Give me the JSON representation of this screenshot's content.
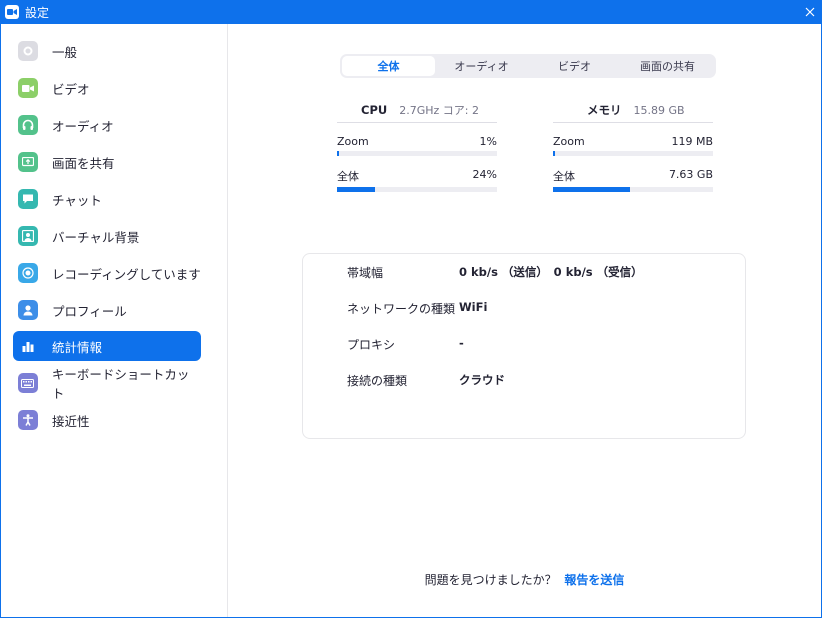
{
  "window": {
    "title": "設定"
  },
  "sidebar": {
    "items": [
      {
        "label": "一般",
        "icon": "gear-icon",
        "color": "#dcdce2"
      },
      {
        "label": "ビデオ",
        "icon": "video-camera-icon",
        "color": "#8ccf68"
      },
      {
        "label": "オーディオ",
        "icon": "headphones-icon",
        "color": "#53c28b"
      },
      {
        "label": "画面を共有",
        "icon": "share-screen-icon",
        "color": "#53c28b"
      },
      {
        "label": "チャット",
        "icon": "chat-bubble-icon",
        "color": "#35b8b0"
      },
      {
        "label": "バーチャル背景",
        "icon": "virtual-background-icon",
        "color": "#35b8b0"
      },
      {
        "label": "レコーディングしています",
        "icon": "record-icon",
        "color": "#39a8e8"
      },
      {
        "label": "プロフィール",
        "icon": "profile-icon",
        "color": "#3d8ee8"
      },
      {
        "label": "統計情報",
        "icon": "statistics-icon",
        "color": "#0e71eb",
        "active": true
      },
      {
        "label": "キーボードショートカット",
        "icon": "keyboard-icon",
        "color": "#7c7fd6"
      },
      {
        "label": "接近性",
        "icon": "accessibility-icon",
        "color": "#7c7fd6"
      }
    ]
  },
  "tabs": [
    {
      "label": "全体",
      "active": true
    },
    {
      "label": "オーディオ"
    },
    {
      "label": "ビデオ"
    },
    {
      "label": "画面の共有"
    }
  ],
  "cpu": {
    "name": "CPU",
    "detail": "2.7GHz  コア: 2",
    "rows": [
      {
        "label": "Zoom",
        "value": "1%",
        "fraction": 0.01
      },
      {
        "label": "全体",
        "value": "24%",
        "fraction": 0.24
      }
    ]
  },
  "memory": {
    "name": "メモリ",
    "detail": "15.89 GB",
    "rows": [
      {
        "label": "Zoom",
        "value": "119 MB",
        "fraction": 0.0075
      },
      {
        "label": "全体",
        "value": "7.63 GB",
        "fraction": 0.48
      }
    ]
  },
  "network": {
    "rows": [
      {
        "label": "帯域幅",
        "value": "0 kb/s （送信）　0 kb/s （受信）"
      },
      {
        "label": "ネットワークの種類",
        "value": "WiFi"
      },
      {
        "label": "プロキシ",
        "value": "-"
      },
      {
        "label": "接続の種類",
        "value": "クラウド"
      }
    ]
  },
  "footer": {
    "question": "問題を見つけましたか？",
    "link": "報告を送信"
  }
}
